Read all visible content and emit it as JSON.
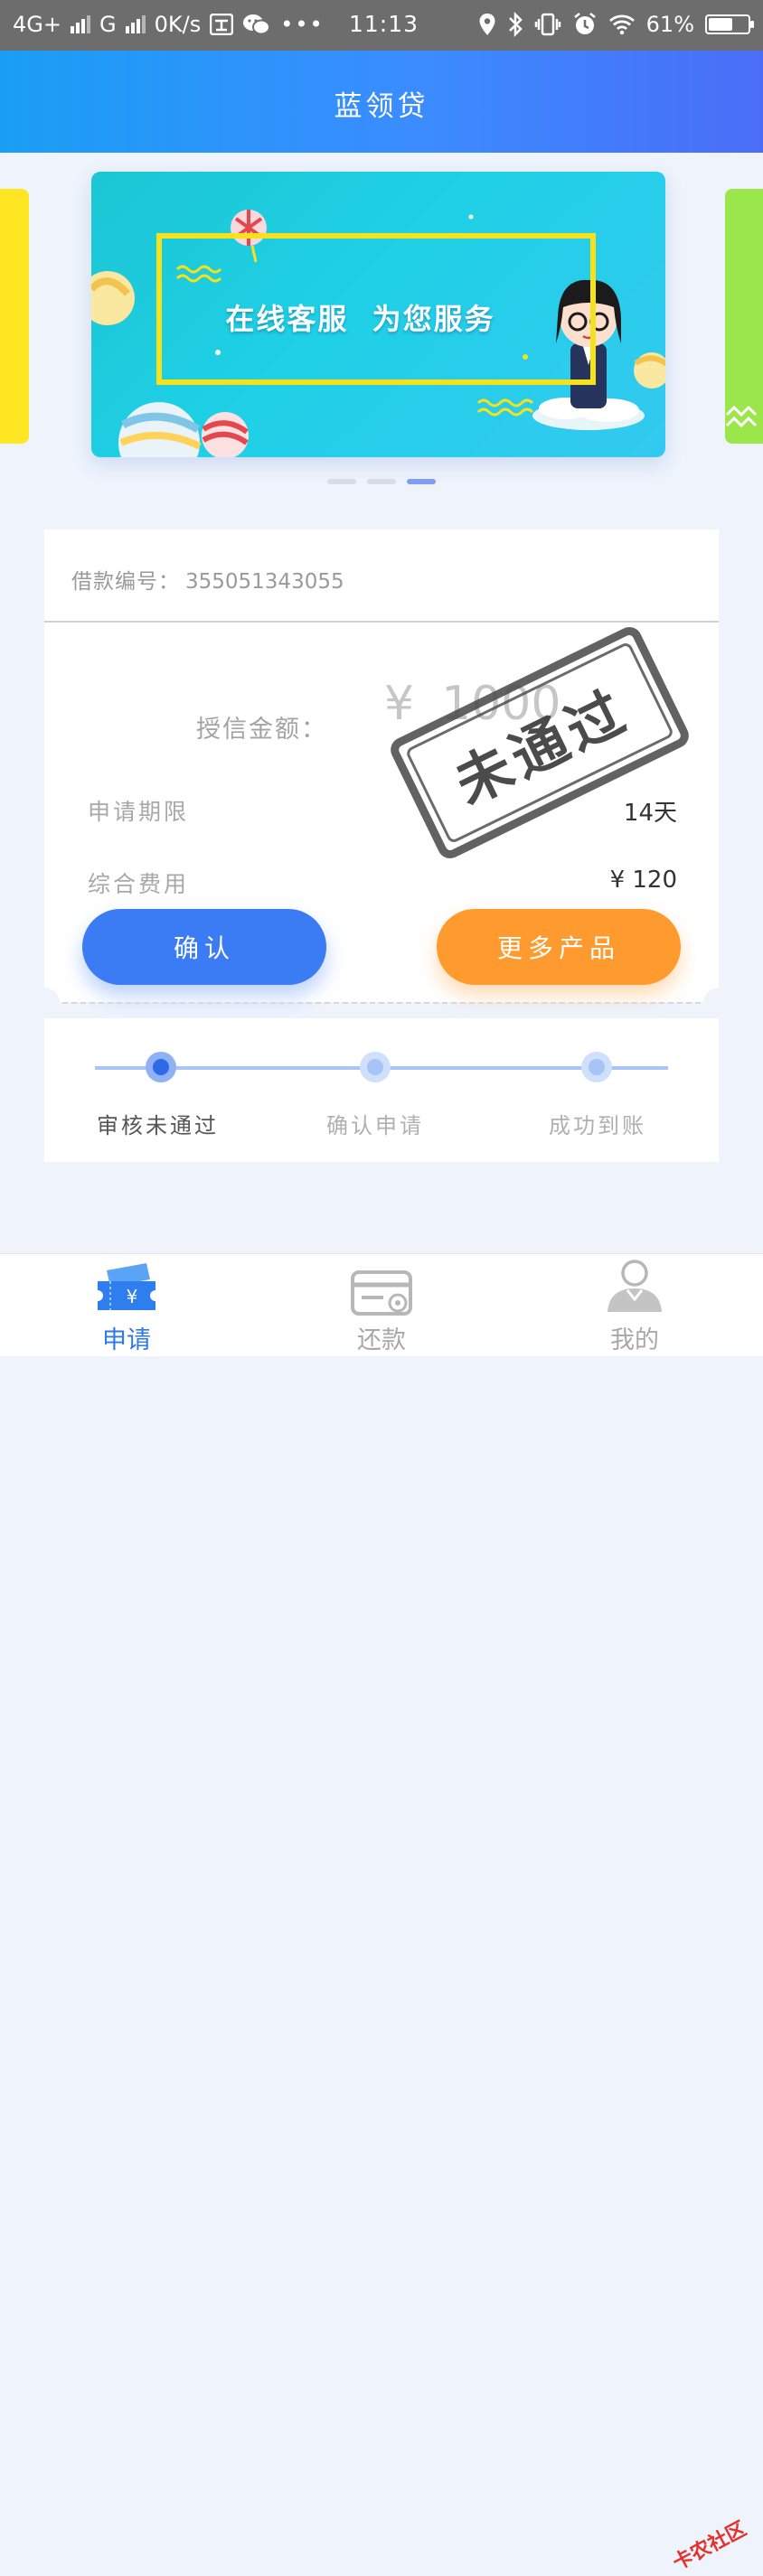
{
  "status_bar": {
    "network_1": "4G+",
    "network_2": "G",
    "speed": "0K/s",
    "time": "11:13",
    "battery": "61%",
    "battery_level": 0.61
  },
  "header": {
    "title": "蓝领贷"
  },
  "banner": {
    "text": "在线客服  为您服务",
    "dot_count": 3,
    "active_dot": 3
  },
  "loan": {
    "number_label": "借款编号：",
    "number": "355051343055",
    "credit_label": "授信金额：",
    "currency": "¥",
    "credit_amount": "1000",
    "stamp": "未通过",
    "term_label": "申请期限",
    "term_value": "14天",
    "fee_label": "综合费用",
    "fee_value": "¥  120",
    "confirm_button": "确认",
    "more_button": "更多产品"
  },
  "progress": {
    "steps": [
      {
        "label": "审核未通过",
        "active": true
      },
      {
        "label": "确认申请",
        "active": false
      },
      {
        "label": "成功到账",
        "active": false
      }
    ]
  },
  "tabbar": {
    "items": [
      {
        "label": "申请",
        "icon": "ticket-icon",
        "active": true
      },
      {
        "label": "还款",
        "icon": "card-icon",
        "active": false
      },
      {
        "label": "我的",
        "icon": "user-icon",
        "active": false
      }
    ]
  },
  "watermark": "卡农社区",
  "colors": {
    "primary": "#3b7bf3",
    "accent": "#ff9a2e",
    "header_start": "#1a9ef5",
    "header_end": "#4a6df7"
  }
}
